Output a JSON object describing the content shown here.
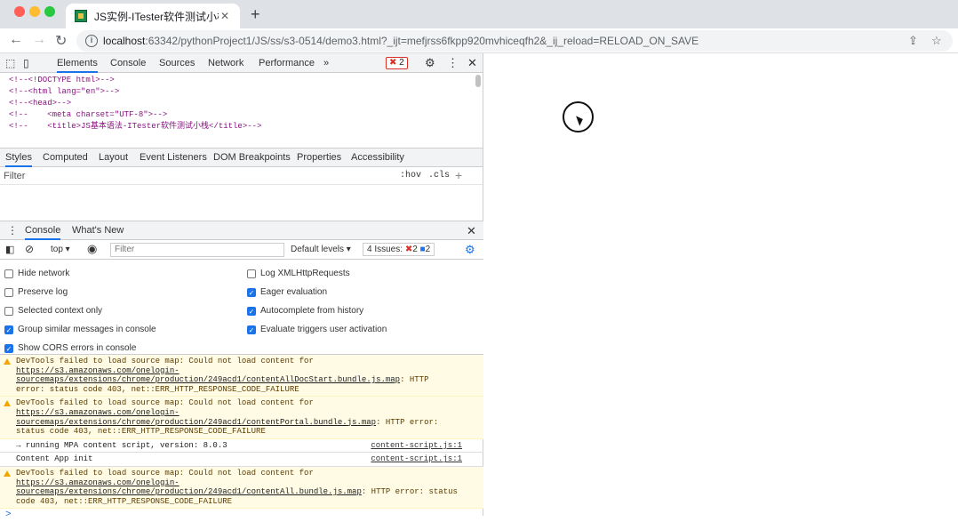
{
  "browser": {
    "tab_title": "JS实例-ITester软件测试小栈",
    "url_host": "localhost",
    "url_rest": ":63342/pythonProject1/JS/ss/s3-0514/demo3.html?_ijt=mefjrss6fkpp920mvhiceqfh2&_ij_reload=RELOAD_ON_SAVE",
    "new_tab": "+",
    "tab_close": "✕"
  },
  "devtools": {
    "tabs": [
      "Elements",
      "Console",
      "Sources",
      "Network",
      "Performance",
      "»"
    ],
    "error_count": "2",
    "dom_lines": [
      "<!--<!DOCTYPE html>-->",
      "<!--<html lang=\"en\">-->",
      "<!--<head>-->",
      "<!--    <meta charset=\"UTF-8\">-->",
      "<!--    <title>JS基本语法-ITester软件测试小栈</title>-->"
    ],
    "sub_tabs": [
      "Styles",
      "Computed",
      "Layout",
      "Event Listeners",
      "DOM Breakpoints",
      "Properties",
      "Accessibility"
    ],
    "styles_filter": "Filter",
    "hov": ":hov",
    "cls": ".cls"
  },
  "drawer": {
    "tabs": [
      "Console",
      "What's New"
    ],
    "context": "top ▾",
    "filter_placeholder": "Filter",
    "levels": "Default levels ▾",
    "issues_label": "4 Issues:",
    "issues_err": "2",
    "issues_info": "2",
    "settings": [
      {
        "label": "Hide network",
        "checked": false
      },
      {
        "label": "Preserve log",
        "checked": false
      },
      {
        "label": "Selected context only",
        "checked": false
      },
      {
        "label": "Group similar messages in console",
        "checked": true
      },
      {
        "label": "Show CORS errors in console",
        "checked": true
      },
      {
        "label": "Log XMLHttpRequests",
        "checked": false
      },
      {
        "label": "Eager evaluation",
        "checked": true
      },
      {
        "label": "Autocomplete from history",
        "checked": true
      },
      {
        "label": "Evaluate triggers user activation",
        "checked": true
      }
    ],
    "messages": [
      {
        "type": "warn",
        "pre": "DevTools failed to load source map: Could not load content for ",
        "link": "https://s3.amazonaws.com/onelogin-sourcemaps/extensions/chrome/production/249acd1/contentAllDocStart.bundle.js.map",
        "post": ": HTTP error: status code 403, net::ERR_HTTP_RESPONSE_CODE_FAILURE",
        "src": ""
      },
      {
        "type": "warn",
        "pre": "DevTools failed to load source map: Could not load content for ",
        "link": "https://s3.amazonaws.com/onelogin-sourcemaps/extensions/chrome/production/249acd1/contentPortal.bundle.js.map",
        "post": ": HTTP error: status code 403, net::ERR_HTTP_RESPONSE_CODE_FAILURE",
        "src": ""
      },
      {
        "type": "log",
        "pre": "→ running MPA content script, version: 8.0.3",
        "link": "",
        "post": "",
        "src": "content-script.js:1"
      },
      {
        "type": "log",
        "pre": "Content App init",
        "link": "",
        "post": "",
        "src": "content-script.js:1"
      },
      {
        "type": "warn",
        "pre": "DevTools failed to load source map: Could not load content for ",
        "link": "https://s3.amazonaws.com/onelogin-sourcemaps/extensions/chrome/production/249acd1/contentAll.bundle.js.map",
        "post": ": HTTP error: status code 403, net::ERR_HTTP_RESPONSE_CODE_FAILURE",
        "src": ""
      }
    ],
    "prompt": ">"
  }
}
